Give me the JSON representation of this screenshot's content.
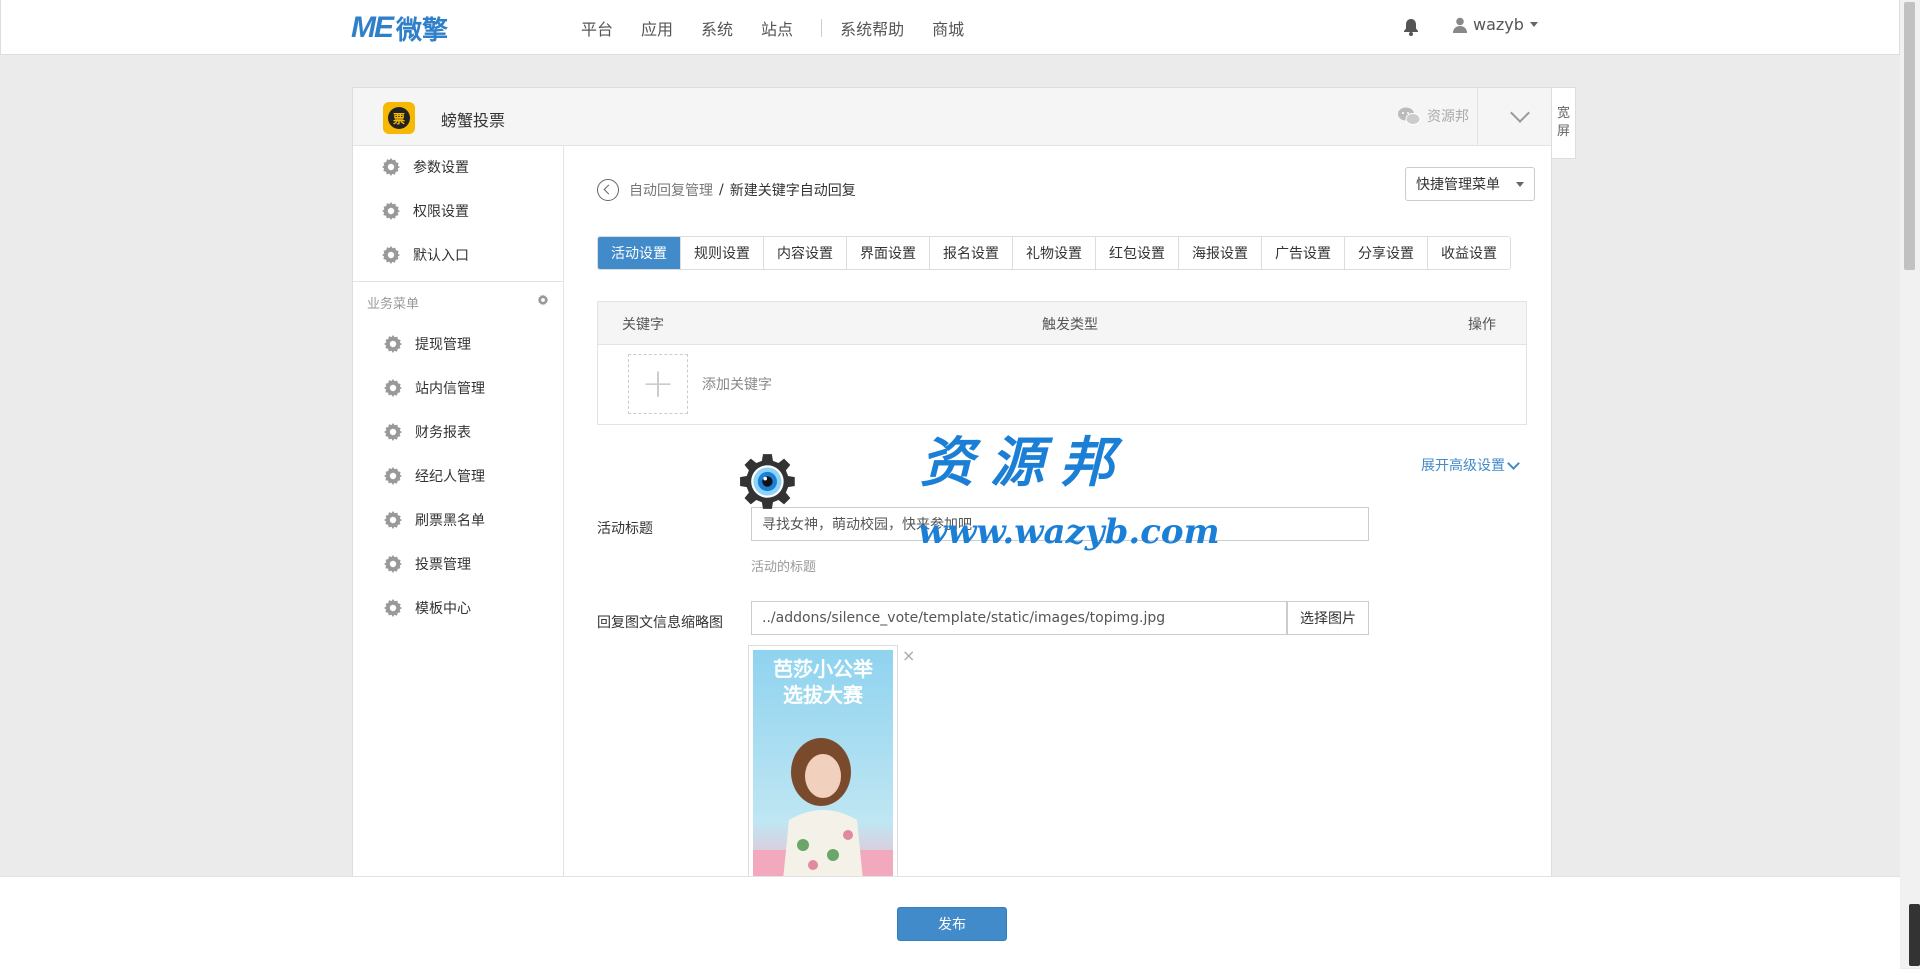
{
  "topbar": {
    "logo_me": "ME",
    "logo_cn": "微擎",
    "nav": [
      "平台",
      "应用",
      "系统",
      "站点",
      "系统帮助",
      "商城"
    ],
    "username": "wazyb"
  },
  "app": {
    "icon_char": "票",
    "name": "螃蟹投票",
    "resource_label": "资源邦",
    "wide_label_1": "宽",
    "wide_label_2": "屏"
  },
  "sidebar": {
    "top_items": [
      "参数设置",
      "权限设置",
      "默认入口"
    ],
    "section_title": "业务菜单",
    "biz_items": [
      "提现管理",
      "站内信管理",
      "财务报表",
      "经纪人管理",
      "刷票黑名单",
      "投票管理",
      "模板中心"
    ]
  },
  "breadcrumb": {
    "parent": "自动回复管理",
    "separator": "/",
    "current": "新建关键字自动回复"
  },
  "quick_menu": "快捷管理菜单",
  "tabs": [
    "活动设置",
    "规则设置",
    "内容设置",
    "界面设置",
    "报名设置",
    "礼物设置",
    "红包设置",
    "海报设置",
    "广告设置",
    "分享设置",
    "收益设置"
  ],
  "active_tab_index": 0,
  "keywords_table": {
    "headers": [
      "关键字",
      "触发类型",
      "操作"
    ],
    "add_label": "添加关键字"
  },
  "advanced_toggle": "展开高级设置",
  "form": {
    "title_label": "活动标题",
    "title_value": "寻找女神，萌动校园，快来参加吧",
    "title_help": "活动的标题",
    "thumb_label": "回复图文信息缩略图",
    "thumb_value": "../addons/silence_vote/template/static/images/topimg.jpg",
    "thumb_button": "选择图片",
    "thumb_remove": "×",
    "poster_title_1": "芭莎小公举",
    "poster_title_2": "选拔大赛"
  },
  "footer": {
    "publish_label": "发布"
  },
  "watermark": {
    "text_cn": "资源邦",
    "text_url": "www.wazyb.com"
  },
  "colors": {
    "primary": "#428bca",
    "logo": "#2f7fc9",
    "watermark": "#1b7fd6"
  }
}
